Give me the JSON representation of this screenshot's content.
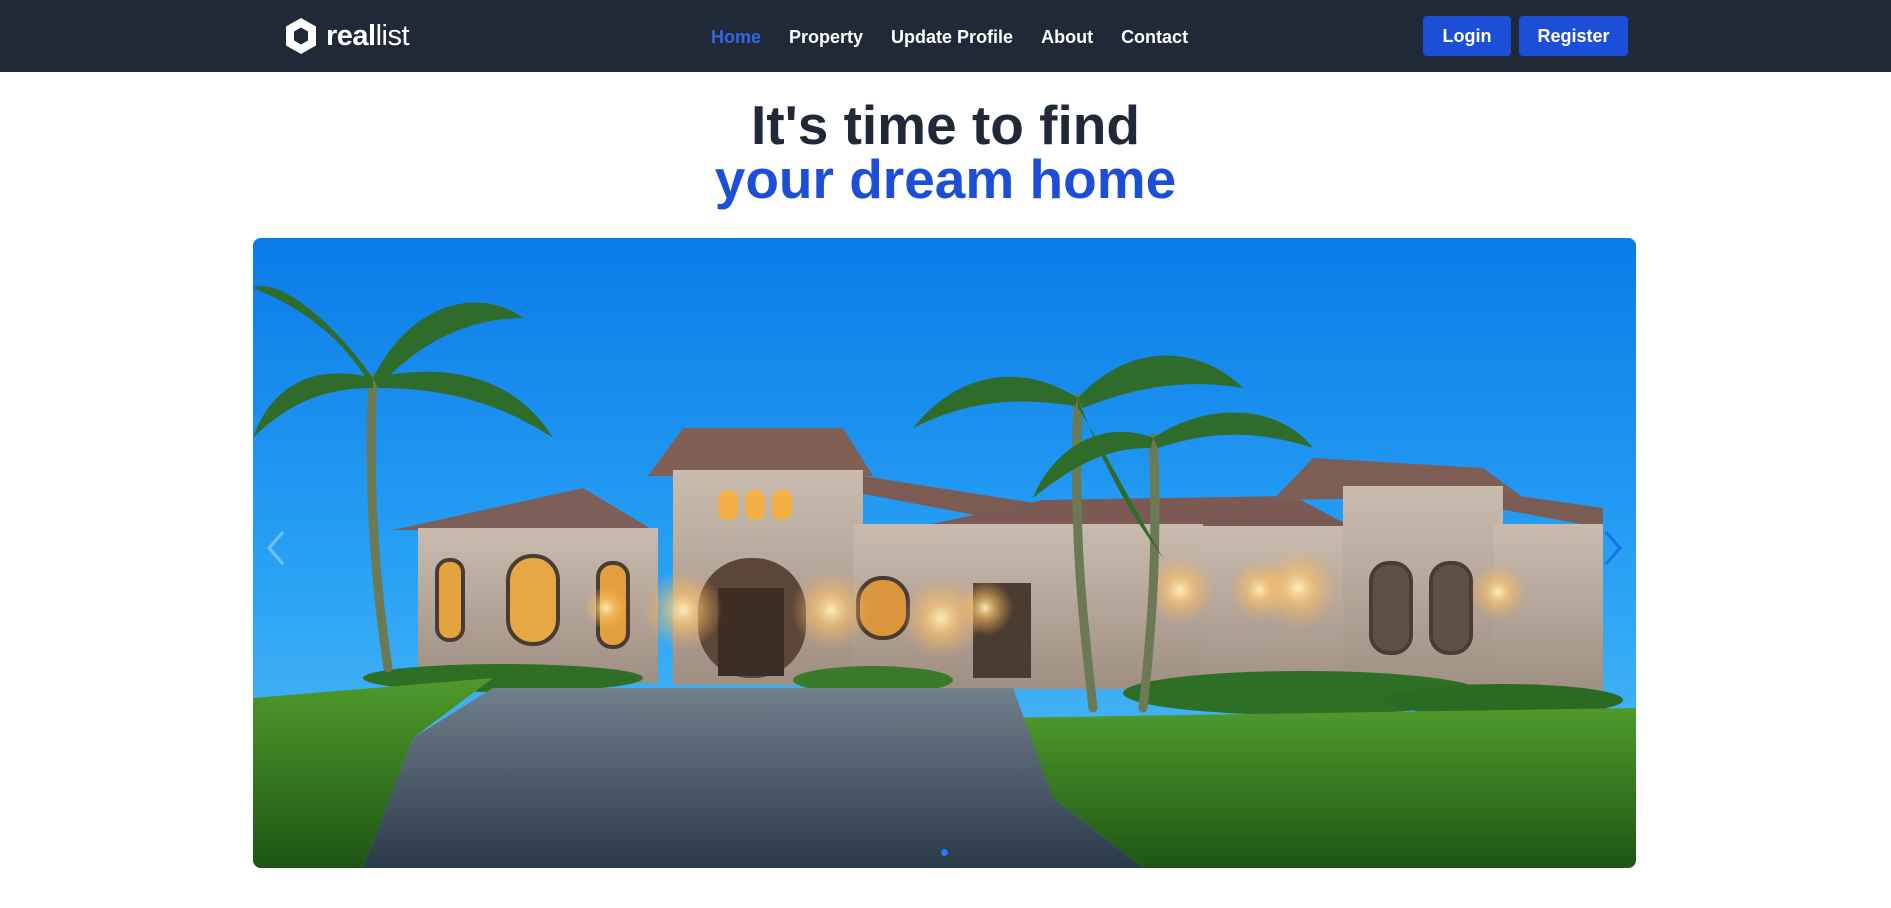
{
  "brand": {
    "name_bold": "real",
    "name_light": "list"
  },
  "nav": {
    "items": [
      {
        "label": "Home",
        "active": true
      },
      {
        "label": "Property",
        "active": false
      },
      {
        "label": "Update Profile",
        "active": false
      },
      {
        "label": "About",
        "active": false
      },
      {
        "label": "Contact",
        "active": false
      }
    ]
  },
  "auth": {
    "login_label": "Login",
    "register_label": "Register"
  },
  "hero": {
    "title_line1": "It's time to find",
    "title_line2": "your dream home"
  },
  "carousel": {
    "slide_count": 1,
    "active_index": 0
  },
  "colors": {
    "header_bg": "#1f2937",
    "accent": "#1d4ed8",
    "nav_active": "#2f68e6",
    "heading": "#1f2937"
  }
}
